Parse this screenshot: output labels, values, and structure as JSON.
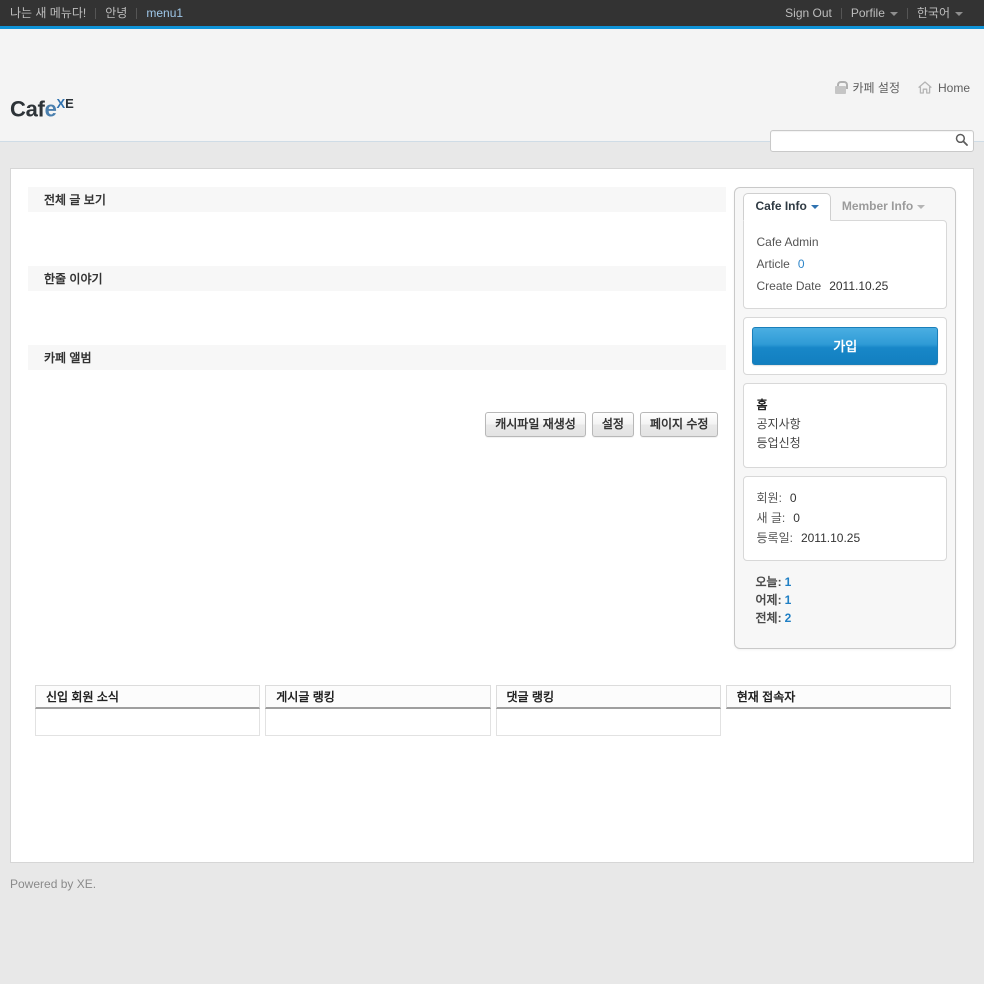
{
  "topbar": {
    "left_items": [
      {
        "label": "나는 새 메뉴다!",
        "accent": false
      },
      {
        "label": "안녕",
        "accent": false
      },
      {
        "label": "menu1",
        "accent": true
      }
    ],
    "right_items": [
      {
        "label": "Sign Out",
        "caret": false
      },
      {
        "label": "Porfile",
        "caret": true
      },
      {
        "label": "한국어",
        "caret": true
      }
    ]
  },
  "header": {
    "logo_main": "Cafe",
    "logo_sup_x": "X",
    "logo_sup_e": "E",
    "links": [
      {
        "label": "카페 설정",
        "icon": "lock-icon"
      },
      {
        "label": "Home",
        "icon": "home-icon"
      }
    ],
    "search": {
      "value": "",
      "placeholder": "",
      "icon": "search-icon"
    }
  },
  "main": {
    "sections": [
      {
        "title": "전체 글 보기"
      },
      {
        "title": "한줄 이야기"
      },
      {
        "title": "카페 앨범"
      }
    ],
    "buttons": [
      {
        "label": "캐시파일 재생성"
      },
      {
        "label": "설정"
      },
      {
        "label": "페이지 수정"
      }
    ]
  },
  "sidebar": {
    "tabs": [
      {
        "label": "Cafe Info",
        "active": true
      },
      {
        "label": "Member Info",
        "active": false
      }
    ],
    "info": [
      {
        "label": "Cafe Admin",
        "value": "",
        "blue": false
      },
      {
        "label": "Article",
        "value": "0",
        "blue": true
      },
      {
        "label": "Create Date",
        "value": "2011.10.25",
        "blue": false
      }
    ],
    "join_button": "가입",
    "menu": [
      {
        "label": "홈",
        "bold": true
      },
      {
        "label": "공지사항",
        "bold": false
      },
      {
        "label": "등업신청",
        "bold": false
      }
    ],
    "stats": [
      {
        "label": "회원:",
        "value": "0"
      },
      {
        "label": "새 글:",
        "value": "0"
      },
      {
        "label": "등록일:",
        "value": "2011.10.25"
      }
    ],
    "visits": [
      {
        "label": "오늘:",
        "value": "1"
      },
      {
        "label": "어제:",
        "value": "1"
      },
      {
        "label": "전체:",
        "value": "2"
      }
    ]
  },
  "bottom_boxes": [
    {
      "title": "신입 회원 소식"
    },
    {
      "title": "게시글 랭킹"
    },
    {
      "title": "댓글 랭킹"
    },
    {
      "title": "현재 접속자"
    }
  ],
  "footer": {
    "text": "Powered by XE."
  },
  "colors": {
    "accent_blue": "#0f93d7",
    "join_blue": "#1887c8",
    "topbar_dark": "#333333",
    "link_blue": "#2f86c9"
  }
}
